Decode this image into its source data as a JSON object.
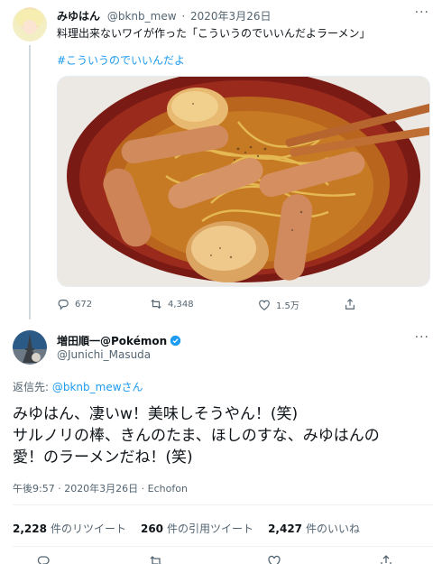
{
  "tweet1": {
    "display_name": "みゆはん",
    "handle": "@bknb_mew",
    "date": "2020年3月26日",
    "text": "料理出来ないワイが作った「こういうのでいいんだよラーメン」",
    "hashtag": "#こういうのでいいんだよ",
    "photo_description_icon": "ramen-photo",
    "replies": "672",
    "retweets": "4,348",
    "likes": "1.5万"
  },
  "tweet2": {
    "display_name": "増田順一@Pokémon",
    "handle": "@Junichi_Masuda",
    "reply_prefix": "返信先: ",
    "reply_handle": "@bknb_mewさん",
    "body_line1": "みゆはん、凄いw！美味しそうやん！(笑)",
    "body_line2": "サルノリの棒、きんのたま、ほしのすな、みゆはんの",
    "body_line3": "愛！のラーメンだね！(笑)",
    "meta": "午後9:57 · 2020年3月26日 · Echofon",
    "stats": {
      "retweets_count": "2,228",
      "retweets_label": "件のリツイート",
      "quotes_count": "260",
      "quotes_label": "件の引用ツイート",
      "likes_count": "2,427",
      "likes_label": "件のいいね"
    }
  },
  "colors": {
    "accent": "#1d9bf0",
    "text": "#0f1419",
    "muted": "#536471",
    "border": "#eff3f4"
  }
}
